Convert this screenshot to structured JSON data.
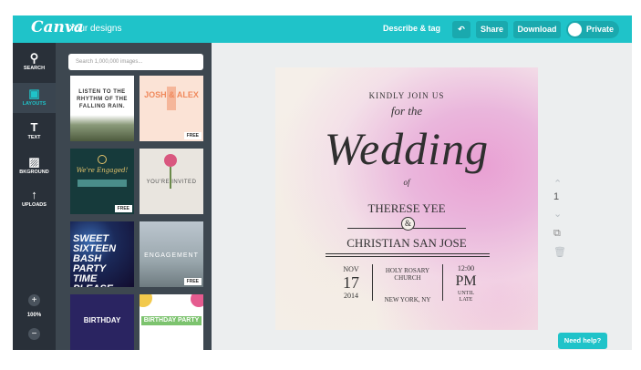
{
  "topbar": {
    "logo": "Canva",
    "breadcrumb": "Your designs",
    "describe_tag": "Describe & tag",
    "share": "Share",
    "download": "Download",
    "private": "Private"
  },
  "sidebar": {
    "items": [
      {
        "label": "SEARCH",
        "icon": "search-icon",
        "glyph": "⚲"
      },
      {
        "label": "LAYOUTS",
        "icon": "layouts-icon",
        "glyph": "▣"
      },
      {
        "label": "TEXT",
        "icon": "text-icon",
        "glyph": "T"
      },
      {
        "label": "BKGROUND",
        "icon": "background-icon",
        "glyph": "▨"
      },
      {
        "label": "UPLOADS",
        "icon": "upload-icon",
        "glyph": "↑"
      }
    ],
    "zoom_in": "+",
    "zoom_level": "100%",
    "zoom_out": "−"
  },
  "panel": {
    "search_placeholder": "Search 1,000,000 images...",
    "thumbs": [
      {
        "text": "LISTEN TO THE RHYTHM OF THE FALLING RAIN.",
        "free": ""
      },
      {
        "text": "JOSH & ALEX",
        "free": "FREE"
      },
      {
        "text": "We're Engaged!",
        "free": "FREE"
      },
      {
        "text": "YOU'RE INVITED",
        "free": ""
      },
      {
        "text": "SWEET SIXTEEN BASH PARTY TIME PLEASE RSVP ASAP",
        "free": ""
      },
      {
        "text": "ENGAGEMENT",
        "free": "FREE"
      },
      {
        "text": "BIRTHDAY",
        "free": ""
      },
      {
        "text": "BIRTHDAY PARTY",
        "free": ""
      }
    ]
  },
  "design": {
    "line1": "KINDLY JOIN US",
    "line2": "for the",
    "line3": "Wedding",
    "line4": "of",
    "name1": "THERESE YEE",
    "amp": "&",
    "name2": "CHRISTIAN SAN JOSE",
    "month": "NOV",
    "day": "17",
    "year": "2014",
    "venue1": "HOLY ROSARY",
    "venue2": "CHURCH",
    "city": "NEW YORK, NY",
    "time": "12:00",
    "ampm": "PM",
    "until1": "UNTIL",
    "until2": "LATE"
  },
  "page_number": "1",
  "need_help": "Need help?"
}
